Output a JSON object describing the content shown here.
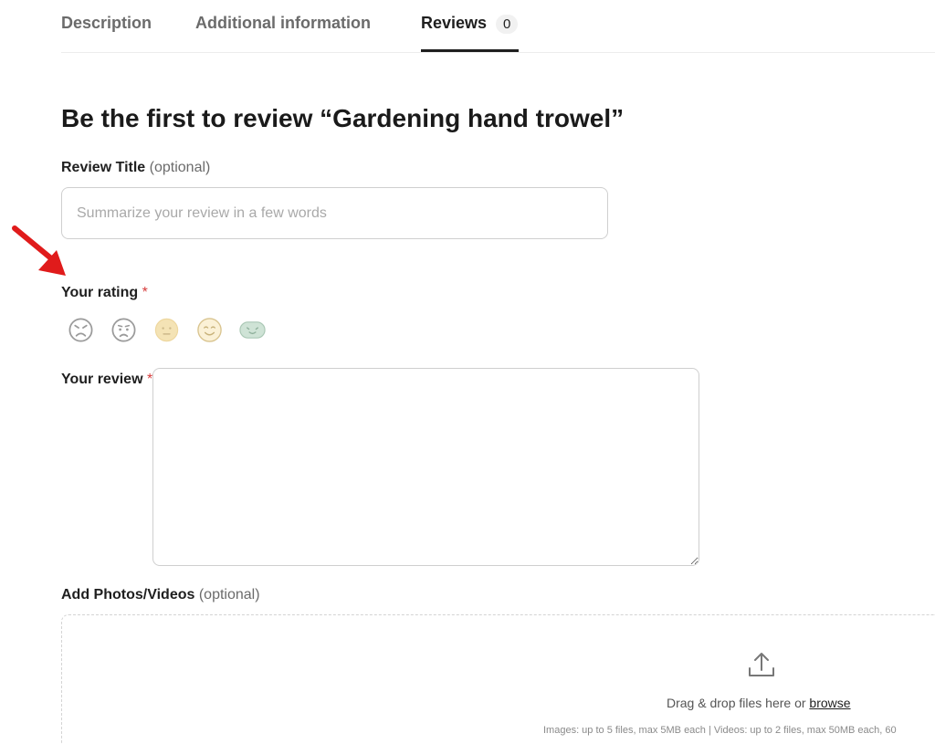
{
  "tabs": [
    {
      "label": "Description"
    },
    {
      "label": "Additional information"
    },
    {
      "label": "Reviews",
      "count": "0",
      "active": true
    }
  ],
  "heading": "Be the first to review “Gardening hand trowel”",
  "review_title": {
    "label": "Review Title",
    "optional": "(optional)",
    "placeholder": "Summarize your review in a few words",
    "value": ""
  },
  "rating": {
    "label": "Your rating",
    "required_mark": "*",
    "options": [
      "angry-face",
      "sad-face",
      "neutral-face",
      "happy-face",
      "very-happy-face"
    ],
    "selected": null
  },
  "review": {
    "label": "Your review",
    "required_mark": "*",
    "value": ""
  },
  "media": {
    "label": "Add Photos/Videos",
    "optional": "(optional)",
    "drop_text": "Drag & drop files here or",
    "browse_label": "browse",
    "limits": "Images: up to 5 files, max 5MB each | Videos: up to 2 files, max 50MB each, 60"
  },
  "colors": {
    "required": "#d63b3b",
    "annotation_arrow": "#e01b1b",
    "face_gray": "#9a9a9a",
    "face_yellow": "#f4e3b5",
    "face_green": "#cfe3d6"
  }
}
